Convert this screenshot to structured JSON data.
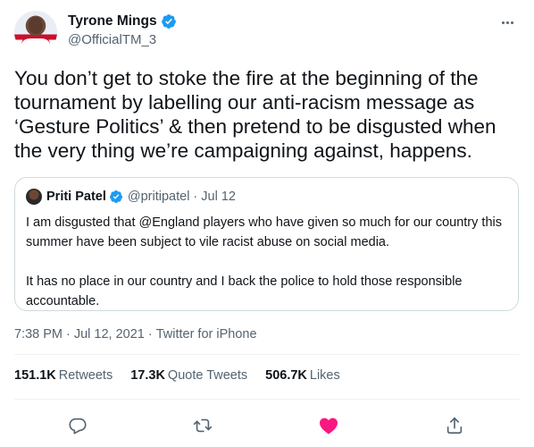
{
  "author": {
    "display_name": "Tyrone Mings",
    "handle": "@OfficialTM_3"
  },
  "tweet": {
    "text": "You don’t get to stoke the fire at the beginning of the tournament by labelling our anti-racism message as ‘Gesture Politics’ & then pretend to be disgusted when the very thing we’re campaigning against, happens."
  },
  "quoted": {
    "display_name": "Priti Patel",
    "handle": "@pritipatel",
    "separator": "·",
    "date": "Jul 12",
    "paragraphs": [
      "I am disgusted that @England players who have given so much for our country this summer have been subject to vile racist abuse on social media.",
      "It has no place in our country and I back the police to hold those responsible accountable."
    ]
  },
  "meta": {
    "time": "7:38 PM",
    "separator": "·",
    "date": "Jul 12, 2021",
    "source": "Twitter for iPhone"
  },
  "stats": [
    {
      "value": "151.1K",
      "label": "Retweets"
    },
    {
      "value": "17.3K",
      "label": "Quote Tweets"
    },
    {
      "value": "506.7K",
      "label": "Likes"
    }
  ],
  "actions": {
    "reply_icon": "reply-icon",
    "retweet_icon": "retweet-icon",
    "like_icon": "heart-icon",
    "share_icon": "share-icon"
  },
  "colors": {
    "verified": "#1d9bf0",
    "like_active": "#f91880",
    "secondary_text": "#536471"
  }
}
